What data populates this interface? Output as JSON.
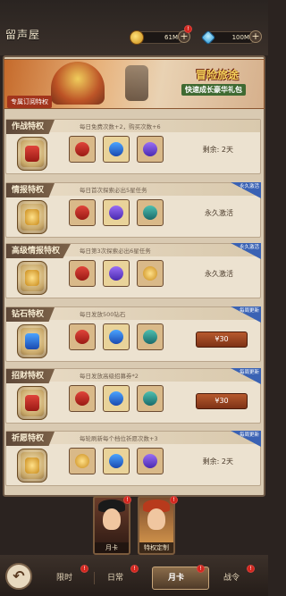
{
  "header": {
    "title": "留声屋",
    "gold": {
      "value": "61M",
      "icon": "gold-coin-icon"
    },
    "gems": {
      "value": "100M",
      "icon": "gem-icon"
    },
    "plus_label": "+"
  },
  "banner": {
    "title": "冒险旅途",
    "subtitle": "快速成长豪华礼包",
    "tag": "专属订阅特权"
  },
  "cards": [
    {
      "name": "作战特权",
      "desc": "每日免费次数+2，购买次数+6",
      "ribbon": "",
      "info": "剩余: 2天",
      "button": "",
      "items": [
        "i-red",
        "i-blue",
        "i-purple"
      ],
      "emblem": "i-red"
    },
    {
      "name": "情报特权",
      "desc": "每日首次探索必出5星任务",
      "ribbon": "永久激活",
      "info": "永久激活",
      "button": "",
      "items": [
        "i-red",
        "i-purple",
        "i-teal"
      ],
      "emblem": "i-gold"
    },
    {
      "name": "高级情报特权",
      "desc": "每日第3次探索必出6星任务",
      "ribbon": "永久激活",
      "info": "永久激活",
      "button": "",
      "items": [
        "i-red",
        "i-purple",
        "i-gold"
      ],
      "emblem": "i-gold"
    },
    {
      "name": "钻石特权",
      "desc": "每日发放500钻石",
      "ribbon": "每周更新",
      "info": "",
      "button": "¥30",
      "items": [
        "i-red",
        "i-blue",
        "i-teal"
      ],
      "emblem": "i-blue"
    },
    {
      "name": "招财特权",
      "desc": "每日发放高级招募券*2",
      "ribbon": "每周更新",
      "info": "",
      "button": "¥30",
      "items": [
        "i-red",
        "i-blue",
        "i-teal"
      ],
      "emblem": "i-red"
    },
    {
      "name": "祈愿特权",
      "desc": "每轮刷新每个档位祈愿次数+3",
      "ribbon": "每周更新",
      "info": "剩余: 2天",
      "button": "",
      "items": [
        "i-gold",
        "i-blue",
        "i-purple"
      ],
      "emblem": "i-gold"
    }
  ],
  "portraits": [
    {
      "label": "月卡"
    },
    {
      "label": "特权定制"
    }
  ],
  "tabs": [
    {
      "label": "限时"
    },
    {
      "label": "日常"
    },
    {
      "label": "月卡"
    },
    {
      "label": "战令"
    }
  ],
  "badge_label": "!"
}
